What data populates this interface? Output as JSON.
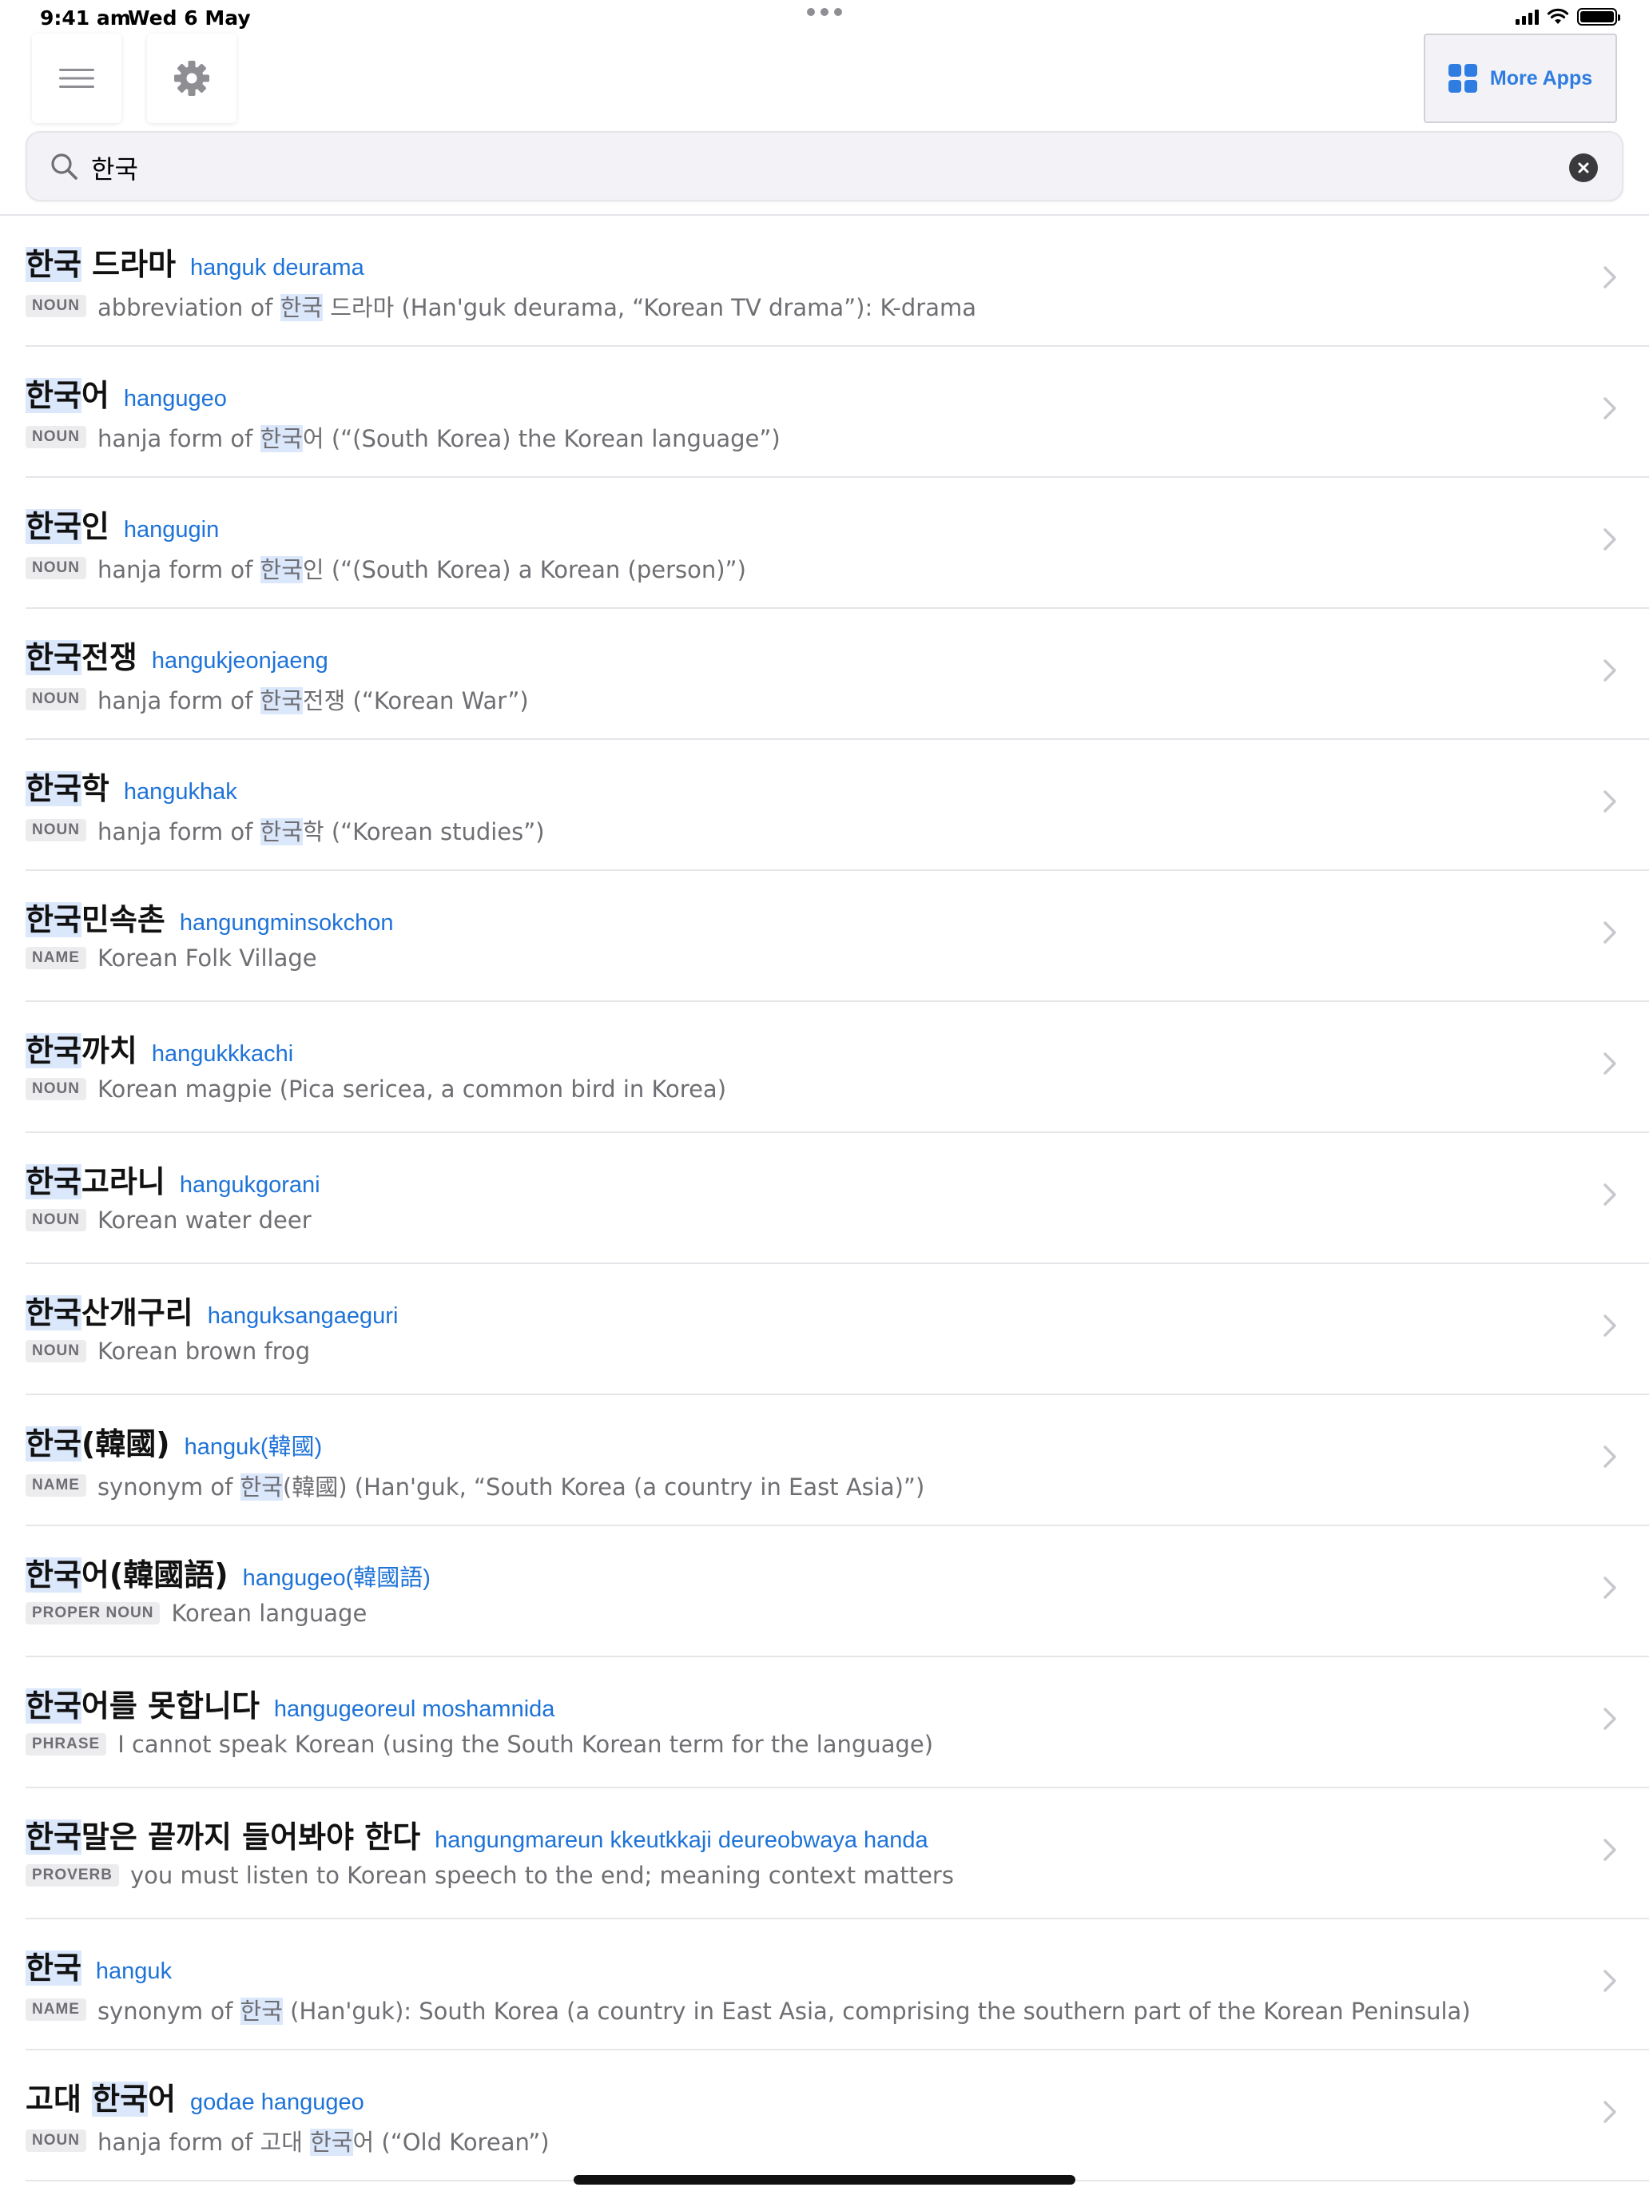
{
  "status_bar": {
    "time": "9:41 am",
    "date": "Wed 6 May"
  },
  "toolbar": {
    "more_apps_label": "More Apps"
  },
  "search": {
    "value": "한국"
  },
  "results": [
    {
      "pre": "",
      "hl": "한국",
      "post": " 드라마",
      "roman": "hanguk deurama",
      "pos": "NOUN",
      "g_pre": "abbreviation of ",
      "g_hl": "한국",
      "g_post": " 드라마 (Han'guk deurama, “Korean TV drama”): K-drama"
    },
    {
      "pre": "",
      "hl": "한국",
      "post": "어",
      "roman": "hangugeo",
      "pos": "NOUN",
      "g_pre": "hanja form of ",
      "g_hl": "한국",
      "g_post": "어 (“(South Korea) the Korean language”)"
    },
    {
      "pre": "",
      "hl": "한국",
      "post": "인",
      "roman": "hangugin",
      "pos": "NOUN",
      "g_pre": "hanja form of ",
      "g_hl": "한국",
      "g_post": "인 (“(South Korea) a Korean (person)”)"
    },
    {
      "pre": "",
      "hl": "한국",
      "post": "전쟁",
      "roman": "hangukjeonjaeng",
      "pos": "NOUN",
      "g_pre": "hanja form of ",
      "g_hl": "한국",
      "g_post": "전쟁 (“Korean War”)"
    },
    {
      "pre": "",
      "hl": "한국",
      "post": "학",
      "roman": "hangukhak",
      "pos": "NOUN",
      "g_pre": "hanja form of ",
      "g_hl": "한국",
      "g_post": "학 (“Korean studies”)"
    },
    {
      "pre": "",
      "hl": "한국",
      "post": "민속촌",
      "roman": "hangungminsokchon",
      "pos": "NAME",
      "g_pre": "Korean Folk Village",
      "g_hl": "",
      "g_post": ""
    },
    {
      "pre": "",
      "hl": "한국",
      "post": "까치",
      "roman": "hangukkkachi",
      "pos": "NOUN",
      "g_pre": "Korean magpie (Pica sericea, a common bird in Korea)",
      "g_hl": "",
      "g_post": ""
    },
    {
      "pre": "",
      "hl": "한국",
      "post": "고라니",
      "roman": "hangukgorani",
      "pos": "NOUN",
      "g_pre": "Korean water deer",
      "g_hl": "",
      "g_post": ""
    },
    {
      "pre": "",
      "hl": "한국",
      "post": "산개구리",
      "roman": "hanguksangaeguri",
      "pos": "NOUN",
      "g_pre": "Korean brown frog",
      "g_hl": "",
      "g_post": ""
    },
    {
      "pre": "",
      "hl": "한국",
      "post": "(韓國)",
      "roman": "hanguk(韓國)",
      "pos": "NAME",
      "g_pre": "synonym of ",
      "g_hl": "한국",
      "g_post": "(韓國) (Han'guk, “South Korea (a country in East Asia)”)"
    },
    {
      "pre": "",
      "hl": "한국",
      "post": "어(韓國語)",
      "roman": "hangugeo(韓國語)",
      "pos": "PROPER NOUN",
      "g_pre": "Korean language",
      "g_hl": "",
      "g_post": ""
    },
    {
      "pre": "",
      "hl": "한국",
      "post": "어를 못합니다",
      "roman": "hangugeoreul moshamnida",
      "pos": "PHRASE",
      "g_pre": "I cannot speak Korean (using the South Korean term for the language)",
      "g_hl": "",
      "g_post": ""
    },
    {
      "pre": "",
      "hl": "한국",
      "post": "말은 끝까지 들어봐야 한다",
      "roman": "hangungmareun kkeutkkaji deureobwaya handa",
      "pos": "PROVERB",
      "g_pre": "you must listen to Korean speech to the end; meaning context matters",
      "g_hl": "",
      "g_post": ""
    },
    {
      "pre": "",
      "hl": "한국",
      "post": "",
      "roman": "hanguk",
      "pos": "NAME",
      "g_pre": "synonym of ",
      "g_hl": "한국",
      "g_post": " (Han'guk): South Korea (a country in East Asia, comprising the southern part of the Korean Peninsula)"
    },
    {
      "pre": "고대 ",
      "hl": "한국",
      "post": "어",
      "roman": "godae hangugeo",
      "pos": "NOUN",
      "g_pre": "hanja form of 고대 ",
      "g_hl": "한국",
      "g_post": "어 (“Old Korean”)"
    }
  ]
}
